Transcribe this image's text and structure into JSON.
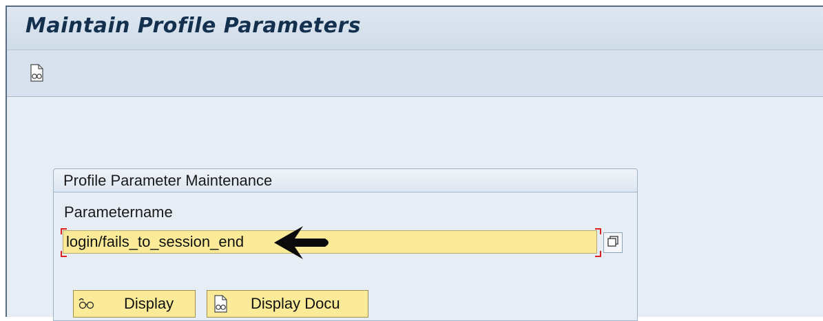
{
  "window": {
    "title": "Maintain Profile Parameters"
  },
  "toolbar": {
    "icons": [
      "display-documentation-icon"
    ]
  },
  "group": {
    "title": "Profile Parameter Maintenance",
    "field_label": "Parametername",
    "field_value": "login/fails_to_session_end",
    "value_help_icon": "value-help-icon"
  },
  "buttons": {
    "display": {
      "label": "Display",
      "icon": "glasses-icon"
    },
    "display_docu": {
      "label": "Display Docu",
      "icon": "document-glasses-icon"
    }
  },
  "colors": {
    "title_text": "#13304f",
    "input_background": "#fbeb99",
    "required_marker": "#e02020",
    "panel_background": "#e6edf5"
  }
}
